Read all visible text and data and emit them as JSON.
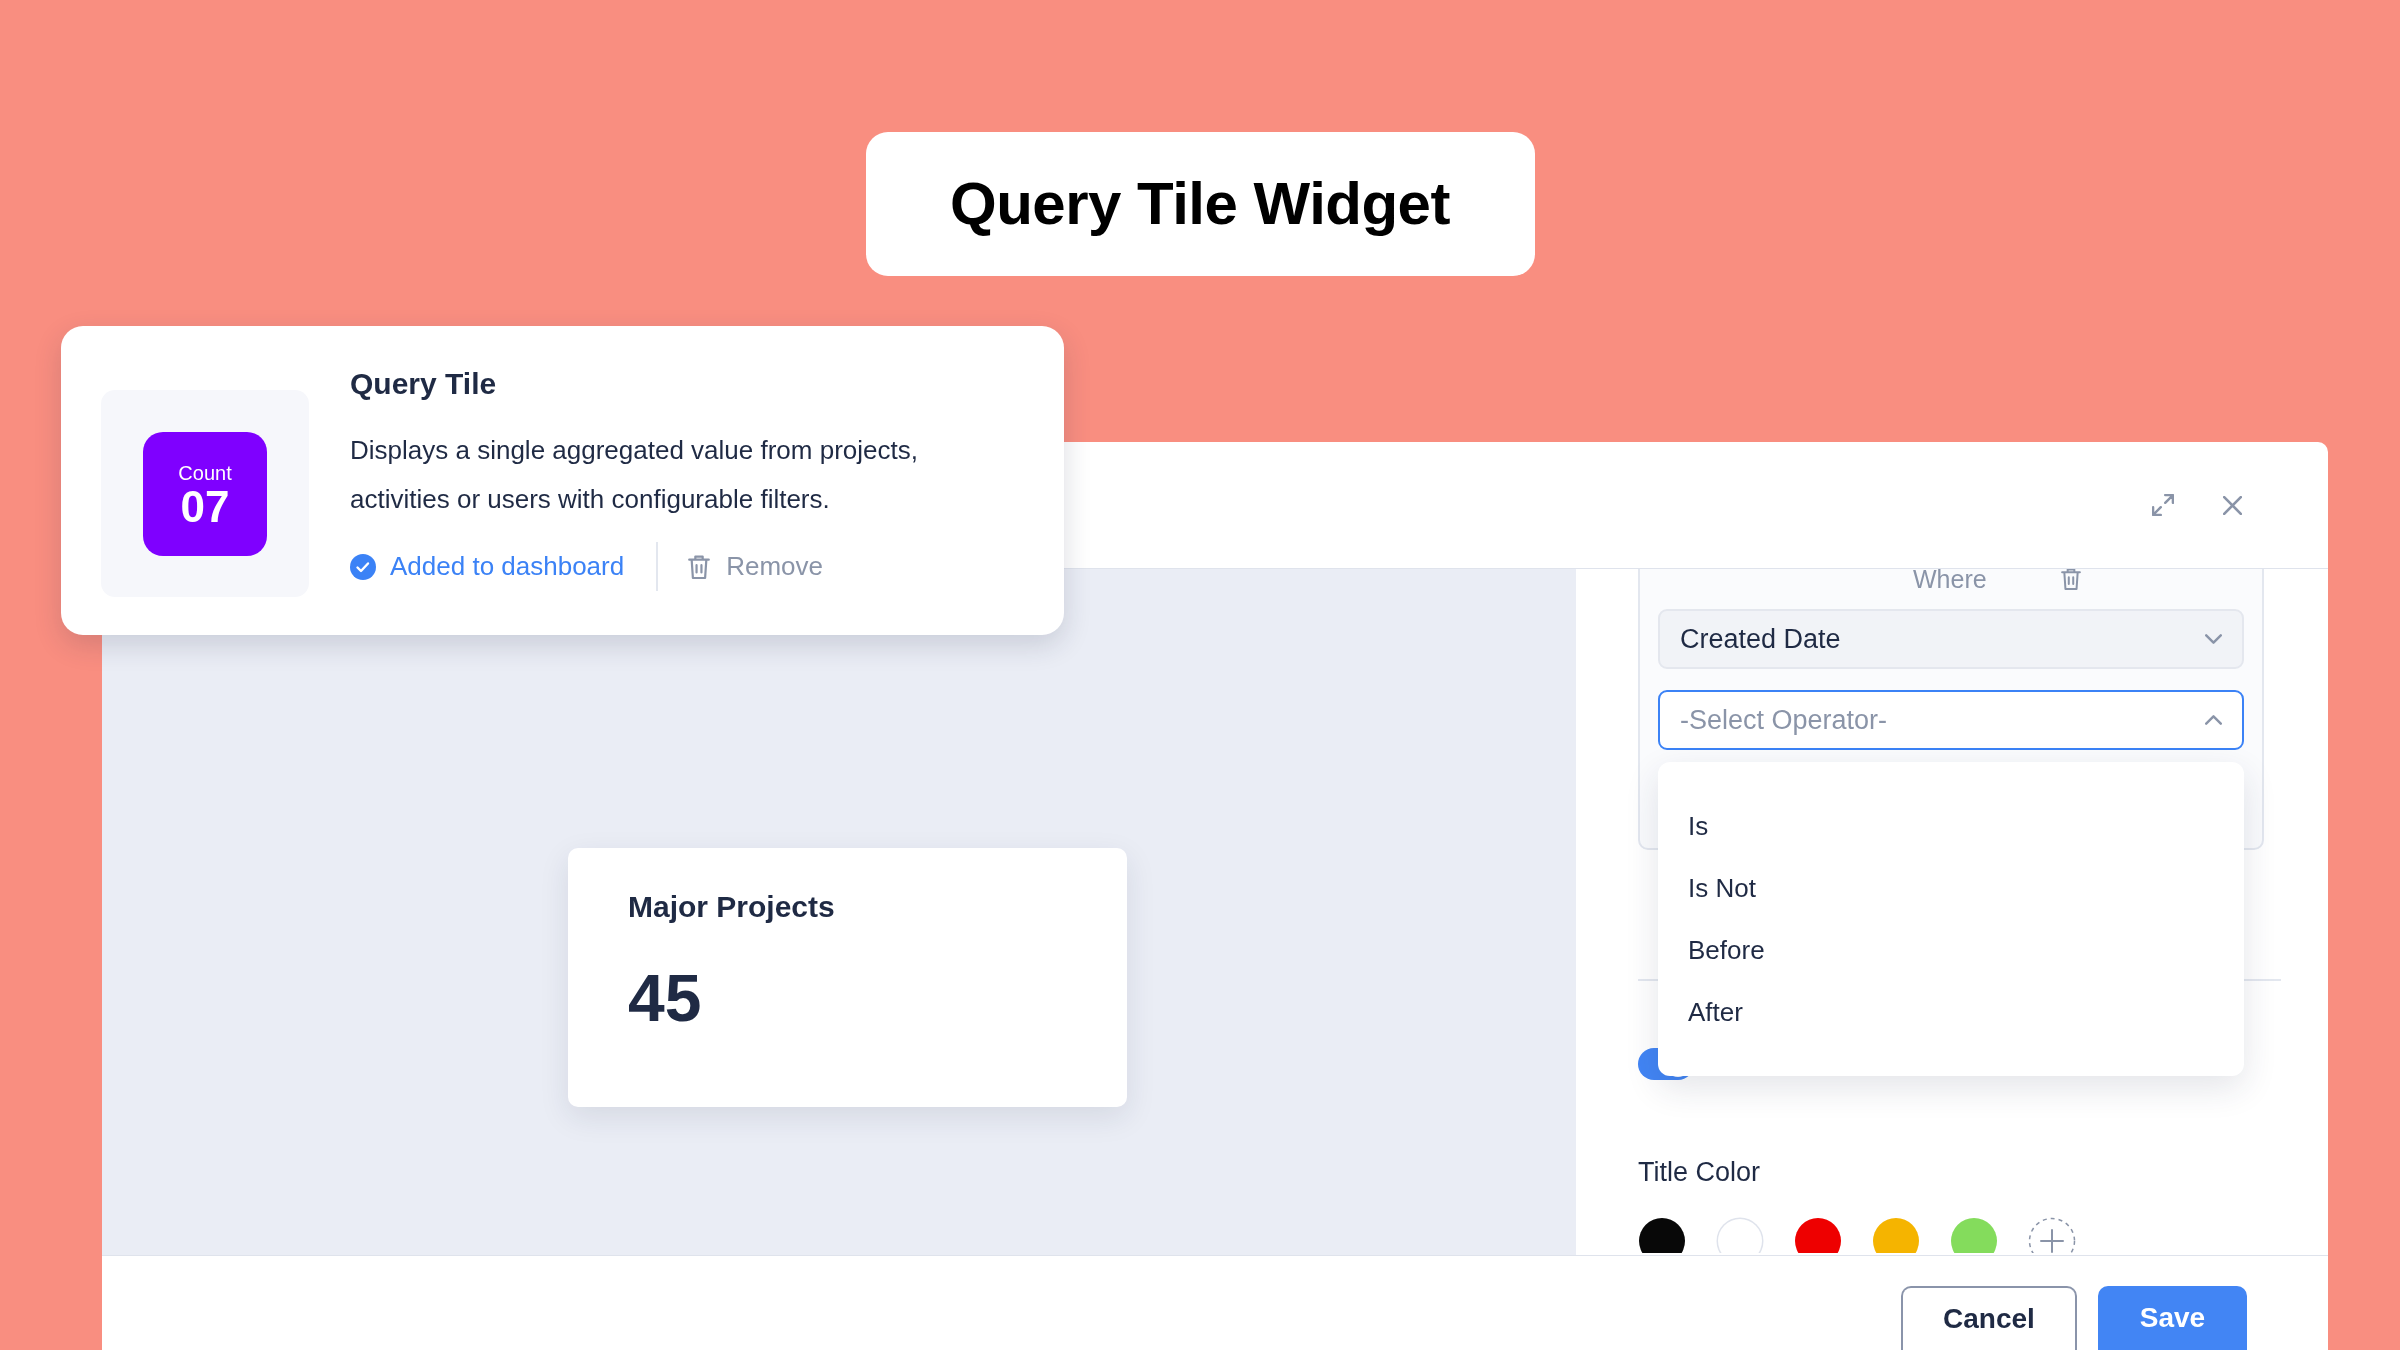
{
  "banner": {
    "title": "Query Tile Widget"
  },
  "widget_card": {
    "badge": {
      "label": "Count",
      "value": "07"
    },
    "title": "Query Tile",
    "description": "Displays a single aggregated value from projects, activities or users with configurable filters.",
    "status": {
      "label": "Added to dashboard",
      "checked": true
    },
    "remove": {
      "label": "Remove"
    }
  },
  "modal": {
    "preview_tile": {
      "title": "Major Projects",
      "value": "45"
    },
    "filter": {
      "label": "Where",
      "field": {
        "value": "Created Date",
        "expanded": false
      },
      "operator": {
        "placeholder": "-Select Operator-",
        "expanded": true
      },
      "options": [
        {
          "label": "Is",
          "selected": false
        },
        {
          "label": "Is Not",
          "selected": false
        },
        {
          "label": "Before",
          "selected": false
        },
        {
          "label": "After",
          "selected": false
        }
      ]
    },
    "toggle": {
      "on": true
    },
    "title_color": {
      "label": "Title Color",
      "swatches": [
        {
          "color": "#080808",
          "selected": false
        },
        {
          "color": "#ffffff",
          "selected": false
        },
        {
          "color": "#ee0000",
          "selected": false
        },
        {
          "color": "#f5b400",
          "selected": false
        },
        {
          "color": "#84dc5c",
          "selected": false
        }
      ]
    },
    "buttons": [
      {
        "label": "Cancel",
        "kind": "secondary"
      },
      {
        "label": "Save",
        "kind": "primary"
      }
    ]
  }
}
